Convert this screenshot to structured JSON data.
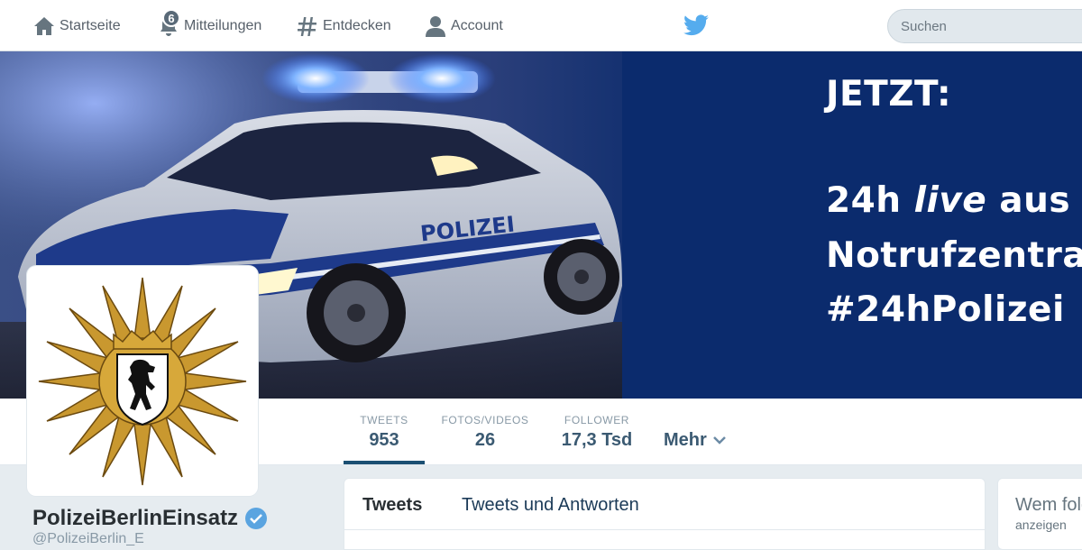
{
  "nav": {
    "home_label": "Startseite",
    "notifications_label": "Mitteilungen",
    "notifications_count": "6",
    "discover_label": "Entdecken",
    "account_label": "Account"
  },
  "search": {
    "placeholder": "Suchen"
  },
  "banner": {
    "line1": "JETZT:",
    "line2_prefix": "24h ",
    "line2_italic": "live",
    "line2_suffix": " aus der",
    "line3": "Notrufzentrale",
    "line4": "#24hPolizei",
    "car_label": "POLIZEI"
  },
  "stats": {
    "tweets_label": "TWEETS",
    "tweets_value": "953",
    "media_label": "FOTOS/VIDEOS",
    "media_value": "26",
    "followers_label": "FOLLOWER",
    "followers_value": "17,3 Tsd",
    "more_label": "Mehr"
  },
  "profile": {
    "name": "PolizeiBerlinEinsatz",
    "handle": "@PolizeiBerlin_E"
  },
  "tabs": {
    "tweets": "Tweets",
    "replies": "Tweets und Antworten"
  },
  "who_to_follow": {
    "title": "Wem folgen?",
    "sub": "anzeigen"
  },
  "colors": {
    "twitter_blue": "#55acee",
    "banner_blue": "#0a2a6e",
    "stat_text": "#3b5a72",
    "verified": "#5aa4e0"
  }
}
